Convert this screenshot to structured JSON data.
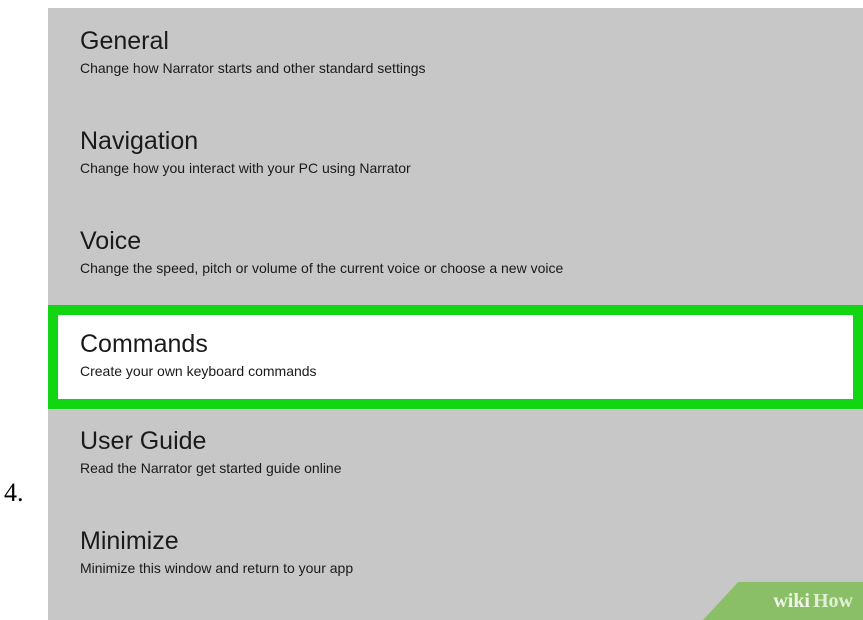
{
  "step_number": "4.",
  "menu": {
    "items": [
      {
        "title": "General",
        "description": "Change how Narrator starts and other standard settings"
      },
      {
        "title": "Navigation",
        "description": "Change how you interact with your PC using Narrator"
      },
      {
        "title": "Voice",
        "description": "Change the speed, pitch or volume of the current voice or choose a new voice"
      },
      {
        "title": "Commands",
        "description": "Create your own keyboard commands"
      },
      {
        "title": "User Guide",
        "description": "Read the Narrator get started guide online"
      },
      {
        "title": "Minimize",
        "description": "Minimize this window and return to your app"
      }
    ],
    "highlighted_item": "Commands",
    "highlight_color": "#12d612"
  },
  "watermark": {
    "wiki": "wiki",
    "how": "How"
  }
}
